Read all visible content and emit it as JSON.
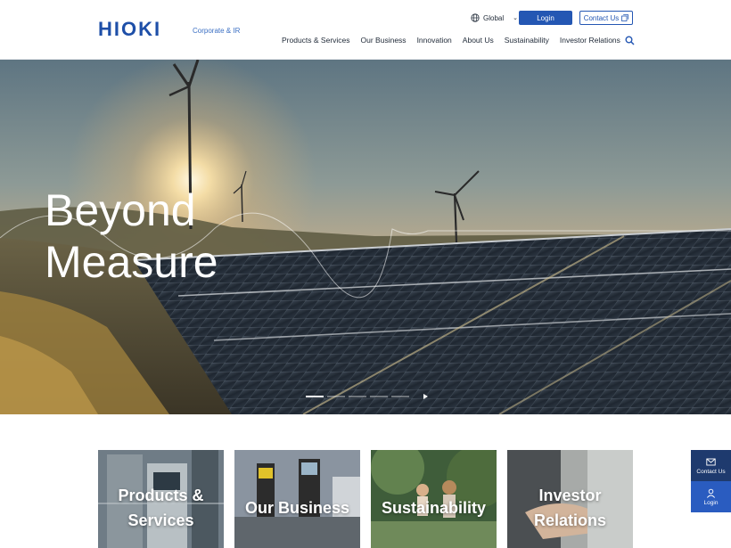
{
  "header": {
    "logo_text": "HIOKI",
    "logo_tagline": "Corporate & IR",
    "global_label": "Global",
    "login_label": "Login",
    "contact_label": "Contact Us",
    "nav": [
      "Products & Services",
      "Our Business",
      "Innovation",
      "About Us",
      "Sustainability",
      "Investor Relations"
    ]
  },
  "hero": {
    "title_line1": "Beyond",
    "title_line2": "Measure",
    "slides_total": 5,
    "active_slide": 1
  },
  "cards": [
    {
      "line1": "Products &",
      "line2": "Services"
    },
    {
      "line1": "Our Business",
      "line2": ""
    },
    {
      "line1": "Sustainability",
      "line2": ""
    },
    {
      "line1": "Investor",
      "line2": "Relations"
    }
  ],
  "floating": {
    "contact_label": "Contact Us",
    "login_label": "Login"
  },
  "colors": {
    "brand_blue": "#2457b3",
    "logo_blue": "#1e4fa8",
    "float_dark": "#1e3a6e",
    "float_light": "#2a5cc0"
  }
}
